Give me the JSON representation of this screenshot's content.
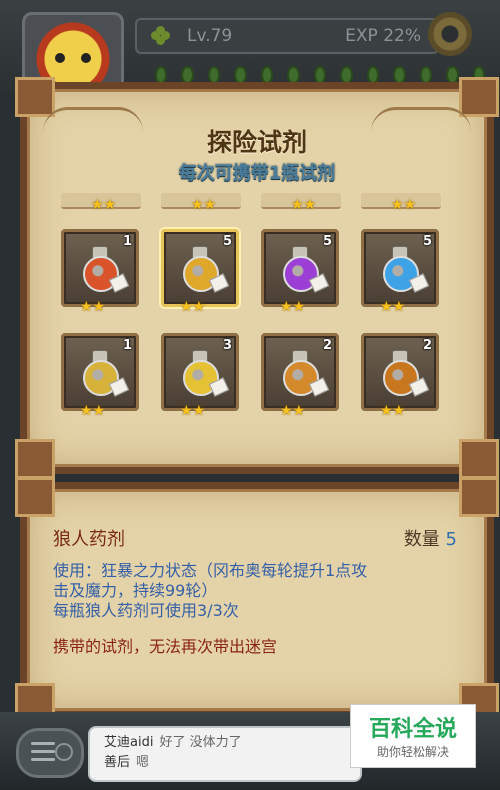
{
  "header": {
    "level": "Lv.79",
    "exp": "EXP 22%"
  },
  "potion_panel": {
    "title": "探险试剂",
    "subtitle": "每次可携带1瓶试剂",
    "items": [
      {
        "count": "1",
        "stars": 2,
        "color": "#d9532b"
      },
      {
        "count": "5",
        "stars": 2,
        "color": "#e0a82a"
      },
      {
        "count": "5",
        "stars": 2,
        "color": "#9b3fd6"
      },
      {
        "count": "5",
        "stars": 2,
        "color": "#3da2e6"
      },
      {
        "count": "1",
        "stars": 2,
        "color": "#d6b23a"
      },
      {
        "count": "3",
        "stars": 2,
        "color": "#e4c234"
      },
      {
        "count": "2",
        "stars": 2,
        "color": "#d48a2a"
      },
      {
        "count": "2",
        "stars": 2,
        "color": "#c9771f"
      }
    ],
    "selected_index": 1
  },
  "detail": {
    "name": "狼人药剂",
    "quantity_label": "数量",
    "quantity_value": "5",
    "desc_line1": "使用：狂暴之力状态（冈布奥每轮提升1点攻",
    "desc_line2": "击及魔力，持续99轮）",
    "desc_line3": "每瓶狼人药剂可使用3/3次",
    "warning": "携带的试剂，无法再次带出迷宫"
  },
  "chat": {
    "line1_user": "艾迪aidi",
    "line1_msg": "好了 没体力了",
    "line2_user": "善后",
    "line2_msg": "嗯"
  },
  "watermark": {
    "big": "百科全说",
    "small": "助你轻松解决"
  },
  "star_glyph": "★"
}
